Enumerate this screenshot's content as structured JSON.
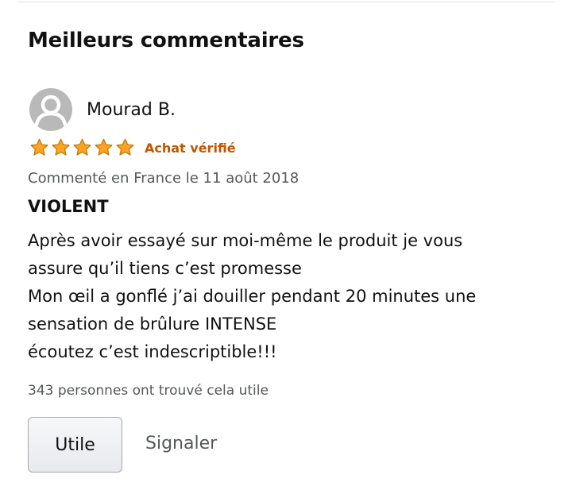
{
  "section": {
    "title": "Meilleurs commentaires"
  },
  "review": {
    "author": "Mourad B.",
    "avatar_icon": "default-user-icon",
    "rating": 5,
    "rating_max": 5,
    "star_color": "#ffa41c",
    "verified_label": "Achat vérifié",
    "verified_color": "#c45500",
    "meta": "Commenté en France le 11 août 2018",
    "title": "VIOLENT",
    "body_lines": [
      "Après avoir essayé sur moi-même le produit je vous",
      "assure qu’il tiens c’est promesse",
      "Mon œil a gonflé j’ai douiller pendant 20 minutes une",
      "sensation de brûlure INTENSE",
      "écoutez c’est indescriptible!!!"
    ],
    "helpful_count": "343 personnes ont trouvé cela utile"
  },
  "actions": {
    "helpful_label": "Utile",
    "report_label": "Signaler"
  }
}
